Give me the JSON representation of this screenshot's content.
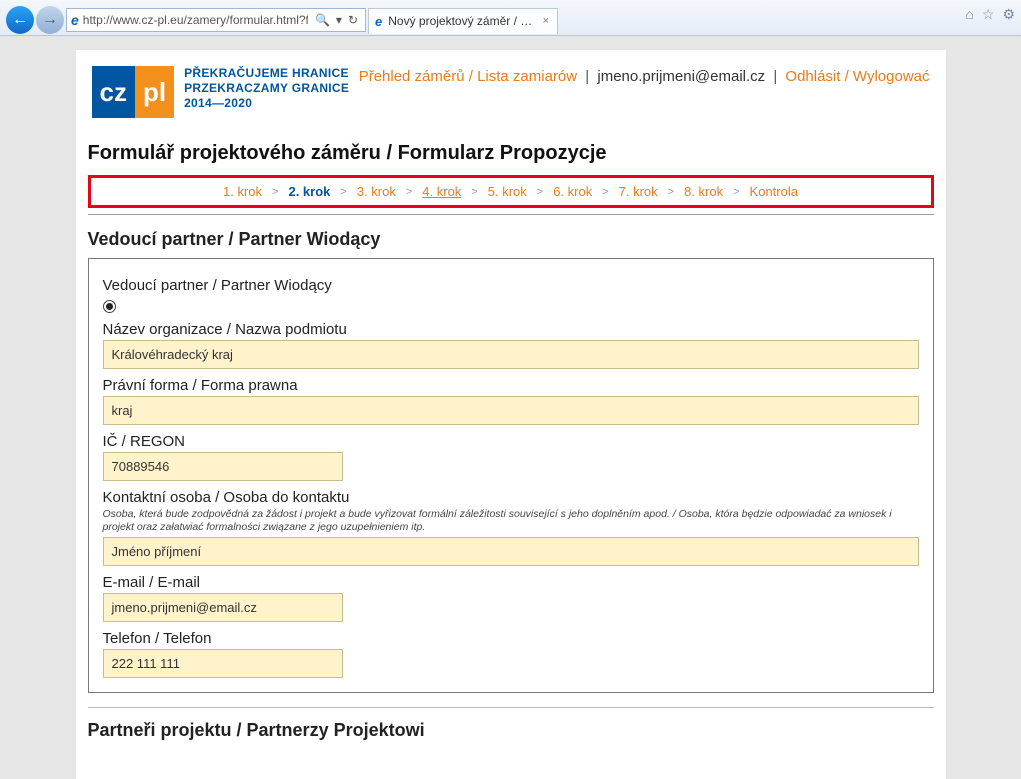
{
  "browser": {
    "url": "http://www.cz-pl.eu/zamery/formular.html?form",
    "search_icon": "🔍",
    "refresh_icon": "↻",
    "dropdown_icon": "▾",
    "tab_title": "Nový projektový záměr / N...",
    "tab_close": "×",
    "home_icon": "⌂",
    "star_icon": "☆",
    "gear_icon": "⚙",
    "back_icon": "←",
    "fwd_icon": "→"
  },
  "logo": {
    "cz": "cz",
    "pl": "pl",
    "line1": "PŘEKRAČUJEME HRANICE",
    "line2": "PRZEKRACZAMY GRANICE",
    "years": "2014—2020"
  },
  "header_links": {
    "overview": "Přehled záměrů / Lista zamiarów",
    "email": "jmeno.prijmeni@email.cz",
    "logout": "Odhlásit / Wylogować"
  },
  "titles": {
    "main": "Formulář projektového záměru / Formularz Propozycje",
    "section1": "Vedoucí partner / Partner Wiodący",
    "panel_title": "Vedoucí partner / Partner Wiodący",
    "section2": "Partneři projektu / Partnerzy Projektowi"
  },
  "steps": [
    {
      "label": "1. krok",
      "active": false,
      "underline": false
    },
    {
      "label": "2. krok",
      "active": true,
      "underline": false
    },
    {
      "label": "3. krok",
      "active": false,
      "underline": false
    },
    {
      "label": "4. krok",
      "active": false,
      "underline": true
    },
    {
      "label": "5. krok",
      "active": false,
      "underline": false
    },
    {
      "label": "6. krok",
      "active": false,
      "underline": false
    },
    {
      "label": "7. krok",
      "active": false,
      "underline": false
    },
    {
      "label": "8. krok",
      "active": false,
      "underline": false
    },
    {
      "label": "Kontrola",
      "active": false,
      "underline": false
    }
  ],
  "step_sep": ">",
  "fields": {
    "org_name_label": "Název organizace / Nazwa podmiotu",
    "org_name_value": "Královéhradecký kraj",
    "legal_form_label": "Právní forma / Forma prawna",
    "legal_form_value": "kraj",
    "regno_label": "IČ / REGON",
    "regno_value": "70889546",
    "contact_label": "Kontaktní osoba / Osoba do kontaktu",
    "contact_help": "Osoba, která bude zodpovědná za žádost i projekt a bude vyřizovat formální záležitosti související s jeho doplněním apod. / Osoba, która będzie odpowiadać za wniosek i projekt oraz załatwiać formalności związane z jego uzupełnieniem itp.",
    "contact_value": "Jméno příjmení",
    "email_label": "E-mail / E-mail",
    "email_value": "jmeno.prijmeni@email.cz",
    "phone_label": "Telefon / Telefon",
    "phone_value": "222 111 111"
  }
}
